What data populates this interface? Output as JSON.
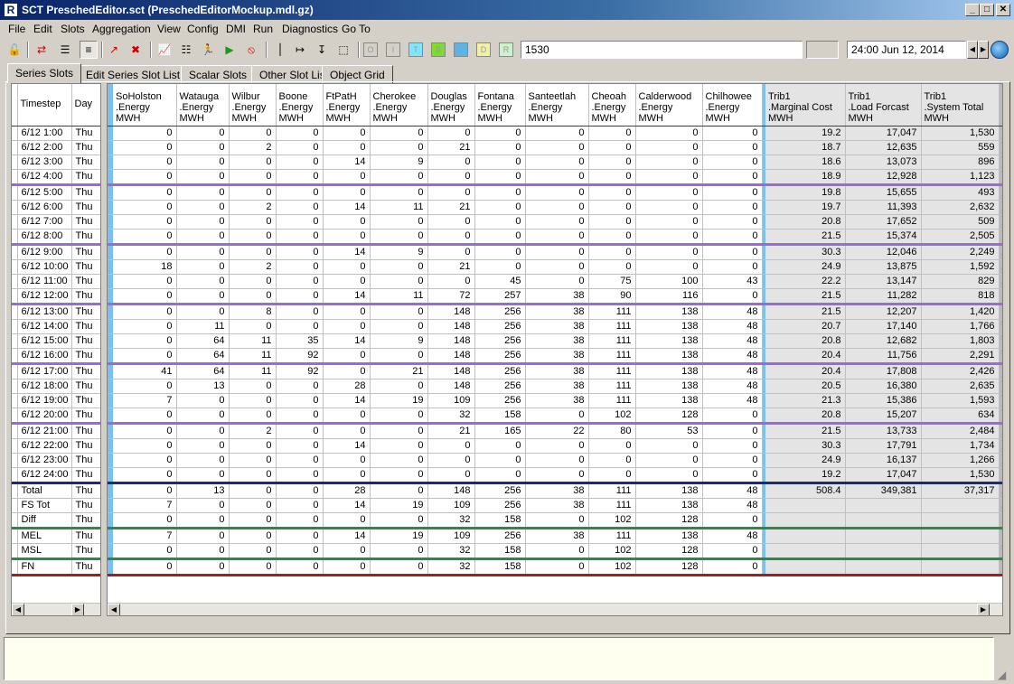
{
  "window": {
    "title": "SCT PreschedEditor.sct (PreschedEditorMockup.mdl.gz)",
    "minimize": "_",
    "maximize": "□",
    "close": "✕"
  },
  "menu": [
    "File",
    "Edit",
    "Slots",
    "Aggregation",
    "View",
    "Config",
    "DMI",
    "Run",
    "Diagnostics",
    "Go To"
  ],
  "toolbar": {
    "value": "1530",
    "date": "24:00 Jun 12, 2014",
    "flag_buttons": [
      {
        "label": "O",
        "color": "#ffffff"
      },
      {
        "label": "I",
        "color": "#ffffff"
      },
      {
        "label": "T",
        "color": "#7fe6ff"
      },
      {
        "label": "B",
        "color": "#7fdc2f"
      },
      {
        "label": "",
        "color": "#5cb3e8"
      },
      {
        "label": "D",
        "color": "#f2f0a8"
      },
      {
        "label": "R",
        "color": "#cdf0cd"
      }
    ]
  },
  "tabs": [
    "Series Slots",
    "Edit Series Slot List",
    "Scalar Slots",
    "Other Slot List",
    "Object Grid"
  ],
  "grid": {
    "left_headers": [
      "Timestep",
      "Day"
    ],
    "columns": [
      {
        "name": "SoHolston",
        "slot": ".Energy",
        "unit": "MWH"
      },
      {
        "name": "Watauga",
        "slot": ".Energy",
        "unit": "MWH"
      },
      {
        "name": "Wilbur",
        "slot": ".Energy",
        "unit": "MWH"
      },
      {
        "name": "Boone",
        "slot": ".Energy",
        "unit": "MWH"
      },
      {
        "name": "FtPatH",
        "slot": ".Energy",
        "unit": "MWH"
      },
      {
        "name": "Cherokee",
        "slot": ".Energy",
        "unit": "MWH"
      },
      {
        "name": "Douglas",
        "slot": ".Energy",
        "unit": "MWH"
      },
      {
        "name": "Fontana",
        "slot": ".Energy",
        "unit": "MWH"
      },
      {
        "name": "Santeetlah",
        "slot": ".Energy",
        "unit": "MWH"
      },
      {
        "name": "Cheoah",
        "slot": ".Energy",
        "unit": "MWH"
      },
      {
        "name": "Calderwood",
        "slot": ".Energy",
        "unit": "MWH"
      },
      {
        "name": "Chilhowee",
        "slot": ".Energy",
        "unit": "MWH"
      }
    ],
    "summary_columns": [
      {
        "name": "Trib1",
        "slot": ".Marginal Cost",
        "unit": "MWH"
      },
      {
        "name": "Trib1",
        "slot": ".Load Forcast",
        "unit": "MWH"
      },
      {
        "name": "Trib1",
        "slot": ".System Total",
        "unit": "MWH"
      }
    ],
    "rows": [
      {
        "t": "6/12 1:00",
        "d": "Thu",
        "v": [
          "0",
          "0",
          "0",
          "0",
          "0",
          "0",
          "0",
          "0",
          "0",
          "0",
          "0",
          "0"
        ],
        "s": [
          "19.2",
          "17,047",
          "1,530"
        ]
      },
      {
        "t": "6/12 2:00",
        "d": "Thu",
        "v": [
          "0",
          "0",
          "2",
          "0",
          "0",
          "0",
          "21",
          "0",
          "0",
          "0",
          "0",
          "0"
        ],
        "s": [
          "18.7",
          "12,635",
          "559"
        ]
      },
      {
        "t": "6/12 3:00",
        "d": "Thu",
        "v": [
          "0",
          "0",
          "0",
          "0",
          "14",
          "9",
          "0",
          "0",
          "0",
          "0",
          "0",
          "0"
        ],
        "s": [
          "18.6",
          "13,073",
          "896"
        ]
      },
      {
        "t": "6/12 4:00",
        "d": "Thu",
        "v": [
          "0",
          "0",
          "0",
          "0",
          "0",
          "0",
          "0",
          "0",
          "0",
          "0",
          "0",
          "0"
        ],
        "s": [
          "18.9",
          "12,928",
          "1,123"
        ],
        "border": "purple"
      },
      {
        "t": "6/12 5:00",
        "d": "Thu",
        "v": [
          "0",
          "0",
          "0",
          "0",
          "0",
          "0",
          "0",
          "0",
          "0",
          "0",
          "0",
          "0"
        ],
        "s": [
          "19.8",
          "15,655",
          "493"
        ]
      },
      {
        "t": "6/12 6:00",
        "d": "Thu",
        "v": [
          "0",
          "0",
          "2",
          "0",
          "14",
          "11",
          "21",
          "0",
          "0",
          "0",
          "0",
          "0"
        ],
        "s": [
          "19.7",
          "11,393",
          "2,632"
        ]
      },
      {
        "t": "6/12 7:00",
        "d": "Thu",
        "v": [
          "0",
          "0",
          "0",
          "0",
          "0",
          "0",
          "0",
          "0",
          "0",
          "0",
          "0",
          "0"
        ],
        "s": [
          "20.8",
          "17,652",
          "509"
        ]
      },
      {
        "t": "6/12 8:00",
        "d": "Thu",
        "v": [
          "0",
          "0",
          "0",
          "0",
          "0",
          "0",
          "0",
          "0",
          "0",
          "0",
          "0",
          "0"
        ],
        "s": [
          "21.5",
          "15,374",
          "2,505"
        ],
        "border": "purple"
      },
      {
        "t": "6/12 9:00",
        "d": "Thu",
        "v": [
          "0",
          "0",
          "0",
          "0",
          "14",
          "9",
          "0",
          "0",
          "0",
          "0",
          "0",
          "0"
        ],
        "s": [
          "30.3",
          "12,046",
          "2,249"
        ]
      },
      {
        "t": "6/12 10:00",
        "d": "Thu",
        "v": [
          "18",
          "0",
          "2",
          "0",
          "0",
          "0",
          "21",
          "0",
          "0",
          "0",
          "0",
          "0"
        ],
        "s": [
          "24.9",
          "13,875",
          "1,592"
        ]
      },
      {
        "t": "6/12 11:00",
        "d": "Thu",
        "v": [
          "0",
          "0",
          "0",
          "0",
          "0",
          "0",
          "0",
          "45",
          "0",
          "75",
          "100",
          "43"
        ],
        "s": [
          "22.2",
          "13,147",
          "829"
        ]
      },
      {
        "t": "6/12 12:00",
        "d": "Thu",
        "v": [
          "0",
          "0",
          "0",
          "0",
          "14",
          "11",
          "72",
          "257",
          "38",
          "90",
          "116",
          "0"
        ],
        "s": [
          "21.5",
          "11,282",
          "818"
        ],
        "border": "purple"
      },
      {
        "t": "6/12 13:00",
        "d": "Thu",
        "v": [
          "0",
          "0",
          "8",
          "0",
          "0",
          "0",
          "148",
          "256",
          "38",
          "111",
          "138",
          "48"
        ],
        "s": [
          "21.5",
          "12,207",
          "1,420"
        ]
      },
      {
        "t": "6/12 14:00",
        "d": "Thu",
        "v": [
          "0",
          "11",
          "0",
          "0",
          "0",
          "0",
          "148",
          "256",
          "38",
          "111",
          "138",
          "48"
        ],
        "s": [
          "20.7",
          "17,140",
          "1,766"
        ]
      },
      {
        "t": "6/12 15:00",
        "d": "Thu",
        "v": [
          "0",
          "64",
          "11",
          "35",
          "14",
          "9",
          "148",
          "256",
          "38",
          "111",
          "138",
          "48"
        ],
        "s": [
          "20.8",
          "12,682",
          "1,803"
        ]
      },
      {
        "t": "6/12 16:00",
        "d": "Thu",
        "v": [
          "0",
          "64",
          "11",
          "92",
          "0",
          "0",
          "148",
          "256",
          "38",
          "111",
          "138",
          "48"
        ],
        "s": [
          "20.4",
          "11,756",
          "2,291"
        ],
        "border": "purple"
      },
      {
        "t": "6/12 17:00",
        "d": "Thu",
        "v": [
          "41",
          "64",
          "11",
          "92",
          "0",
          "21",
          "148",
          "256",
          "38",
          "111",
          "138",
          "48"
        ],
        "s": [
          "20.4",
          "17,808",
          "2,426"
        ]
      },
      {
        "t": "6/12 18:00",
        "d": "Thu",
        "v": [
          "0",
          "13",
          "0",
          "0",
          "28",
          "0",
          "148",
          "256",
          "38",
          "111",
          "138",
          "48"
        ],
        "s": [
          "20.5",
          "16,380",
          "2,635"
        ]
      },
      {
        "t": "6/12 19:00",
        "d": "Thu",
        "v": [
          "7",
          "0",
          "0",
          "0",
          "14",
          "19",
          "109",
          "256",
          "38",
          "111",
          "138",
          "48"
        ],
        "s": [
          "21.3",
          "15,386",
          "1,593"
        ]
      },
      {
        "t": "6/12 20:00",
        "d": "Thu",
        "v": [
          "0",
          "0",
          "0",
          "0",
          "0",
          "0",
          "32",
          "158",
          "0",
          "102",
          "128",
          "0"
        ],
        "s": [
          "20.8",
          "15,207",
          "634"
        ],
        "border": "purple"
      },
      {
        "t": "6/12 21:00",
        "d": "Thu",
        "v": [
          "0",
          "0",
          "2",
          "0",
          "0",
          "0",
          "21",
          "165",
          "22",
          "80",
          "53",
          "0"
        ],
        "s": [
          "21.5",
          "13,733",
          "2,484"
        ]
      },
      {
        "t": "6/12 22:00",
        "d": "Thu",
        "v": [
          "0",
          "0",
          "0",
          "0",
          "14",
          "0",
          "0",
          "0",
          "0",
          "0",
          "0",
          "0"
        ],
        "s": [
          "30.3",
          "17,791",
          "1,734"
        ]
      },
      {
        "t": "6/12 23:00",
        "d": "Thu",
        "v": [
          "0",
          "0",
          "0",
          "0",
          "0",
          "0",
          "0",
          "0",
          "0",
          "0",
          "0",
          "0"
        ],
        "s": [
          "24.9",
          "16,137",
          "1,266"
        ]
      },
      {
        "t": "6/12 24:00",
        "d": "Thu",
        "v": [
          "0",
          "0",
          "0",
          "0",
          "0",
          "0",
          "0",
          "0",
          "0",
          "0",
          "0",
          "0"
        ],
        "s": [
          "19.2",
          "17,047",
          "1,530"
        ],
        "border": "navy"
      }
    ],
    "summary_rows": [
      {
        "t": "Total",
        "d": "Thu",
        "v": [
          "0",
          "13",
          "0",
          "0",
          "28",
          "0",
          "148",
          "256",
          "38",
          "111",
          "138",
          "48"
        ],
        "s": [
          "508.4",
          "349,381",
          "37,317"
        ]
      },
      {
        "t": "FS Tot",
        "d": "Thu",
        "v": [
          "7",
          "0",
          "0",
          "0",
          "14",
          "19",
          "109",
          "256",
          "38",
          "111",
          "138",
          "48"
        ],
        "s": [
          "",
          "",
          ""
        ]
      },
      {
        "t": "Diff",
        "d": "Thu",
        "v": [
          "0",
          "0",
          "0",
          "0",
          "0",
          "0",
          "32",
          "158",
          "0",
          "102",
          "128",
          "0"
        ],
        "s": [
          "",
          "",
          ""
        ],
        "border": "green"
      },
      {
        "t": "MEL",
        "d": "Thu",
        "v": [
          "7",
          "0",
          "0",
          "0",
          "14",
          "19",
          "109",
          "256",
          "38",
          "111",
          "138",
          "48"
        ],
        "s": [
          "",
          "",
          ""
        ]
      },
      {
        "t": "MSL",
        "d": "Thu",
        "v": [
          "0",
          "0",
          "0",
          "0",
          "0",
          "0",
          "32",
          "158",
          "0",
          "102",
          "128",
          "0"
        ],
        "s": [
          "",
          "",
          ""
        ],
        "border": "green"
      },
      {
        "t": "FN",
        "d": "Thu",
        "v": [
          "0",
          "0",
          "0",
          "0",
          "0",
          "0",
          "32",
          "158",
          "0",
          "102",
          "128",
          "0"
        ],
        "s": [
          "",
          "",
          ""
        ],
        "border": "red"
      }
    ]
  }
}
